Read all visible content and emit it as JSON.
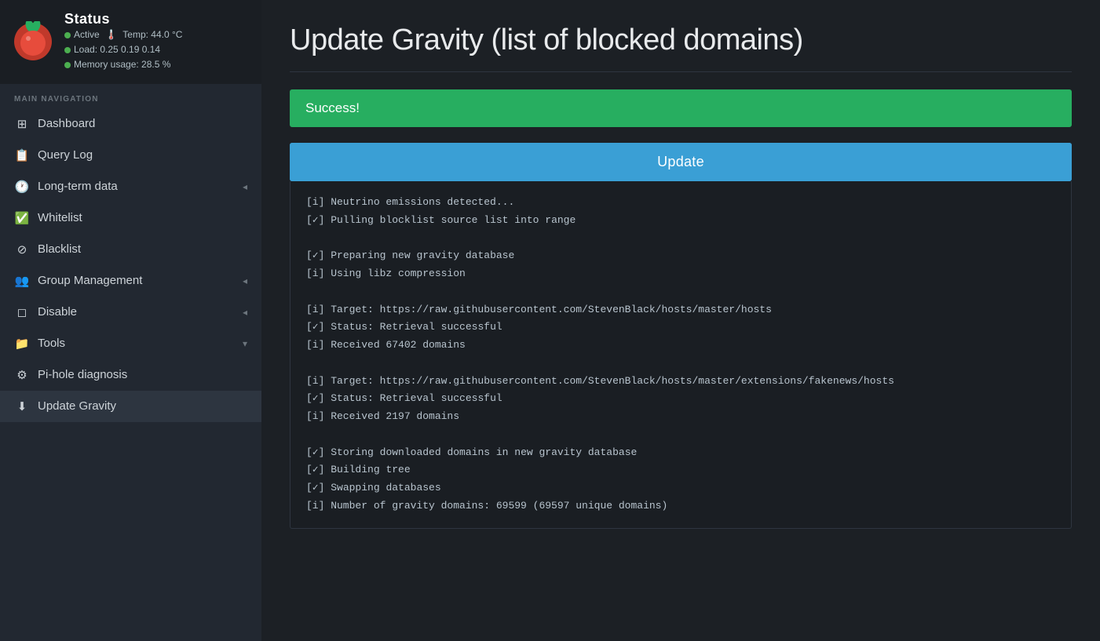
{
  "sidebar": {
    "title": "Status",
    "status": {
      "active_label": "Active",
      "temp_label": "Temp: 44.0 °C",
      "load_label": "Load:  0.25  0.19  0.14",
      "memory_label": "Memory usage:  28.5 %"
    },
    "nav_section_label": "MAIN NAVIGATION",
    "nav_items": [
      {
        "id": "dashboard",
        "label": "Dashboard",
        "icon": "⊞",
        "has_chevron": false
      },
      {
        "id": "query-log",
        "label": "Query Log",
        "icon": "📄",
        "has_chevron": false
      },
      {
        "id": "long-term-data",
        "label": "Long-term data",
        "icon": "🕐",
        "has_chevron": true
      },
      {
        "id": "whitelist",
        "label": "Whitelist",
        "icon": "✅",
        "has_chevron": false
      },
      {
        "id": "blacklist",
        "label": "Blacklist",
        "icon": "⊘",
        "has_chevron": false
      },
      {
        "id": "group-management",
        "label": "Group Management",
        "icon": "👥",
        "has_chevron": true
      },
      {
        "id": "disable",
        "label": "Disable",
        "icon": "◻",
        "has_chevron": true
      },
      {
        "id": "tools",
        "label": "Tools",
        "icon": "📁",
        "has_chevron": true,
        "expanded": true
      },
      {
        "id": "pi-hole-diagnosis",
        "label": "Pi-hole diagnosis",
        "icon": "⚙",
        "has_chevron": false
      },
      {
        "id": "update-gravity",
        "label": "Update Gravity",
        "icon": "⬇",
        "has_chevron": false,
        "active": true
      }
    ]
  },
  "main": {
    "page_title": "Update Gravity (list of blocked domains)",
    "success_message": "Success!",
    "update_button_label": "Update",
    "log_lines": "[i] Neutrino emissions detected...\n[✓] Pulling blocklist source list into range\n\n[✓] Preparing new gravity database\n[i] Using libz compression\n\n[i] Target: https://raw.githubusercontent.com/StevenBlack/hosts/master/hosts\n[✓] Status: Retrieval successful\n[i] Received 67402 domains\n\n[i] Target: https://raw.githubusercontent.com/StevenBlack/hosts/master/extensions/fakenews/hosts\n[✓] Status: Retrieval successful\n[i] Received 2197 domains\n\n[✓] Storing downloaded domains in new gravity database\n[✓] Building tree\n[✓] Swapping databases\n[i] Number of gravity domains: 69599 (69597 unique domains)"
  }
}
